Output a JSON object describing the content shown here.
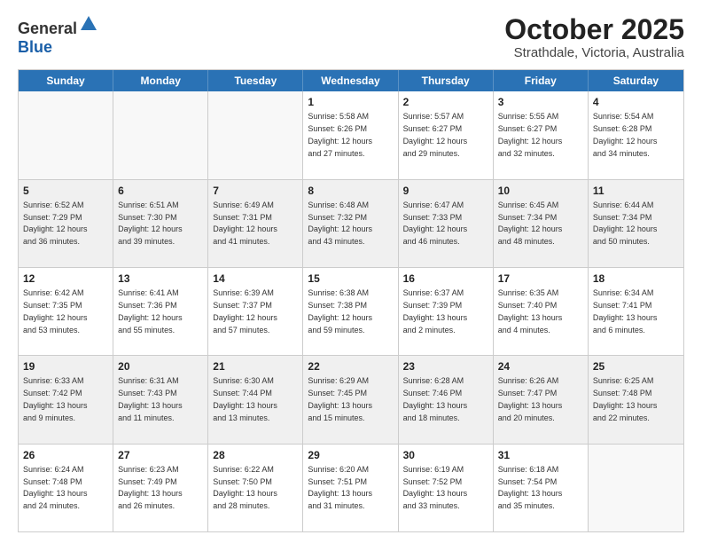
{
  "header": {
    "logo": {
      "general": "General",
      "blue": "Blue"
    },
    "title": "October 2025",
    "location": "Strathdale, Victoria, Australia"
  },
  "days_of_week": [
    "Sunday",
    "Monday",
    "Tuesday",
    "Wednesday",
    "Thursday",
    "Friday",
    "Saturday"
  ],
  "weeks": [
    [
      {
        "day": "",
        "info": ""
      },
      {
        "day": "",
        "info": ""
      },
      {
        "day": "",
        "info": ""
      },
      {
        "day": "1",
        "info": "Sunrise: 5:58 AM\nSunset: 6:26 PM\nDaylight: 12 hours\nand 27 minutes."
      },
      {
        "day": "2",
        "info": "Sunrise: 5:57 AM\nSunset: 6:27 PM\nDaylight: 12 hours\nand 29 minutes."
      },
      {
        "day": "3",
        "info": "Sunrise: 5:55 AM\nSunset: 6:27 PM\nDaylight: 12 hours\nand 32 minutes."
      },
      {
        "day": "4",
        "info": "Sunrise: 5:54 AM\nSunset: 6:28 PM\nDaylight: 12 hours\nand 34 minutes."
      }
    ],
    [
      {
        "day": "5",
        "info": "Sunrise: 6:52 AM\nSunset: 7:29 PM\nDaylight: 12 hours\nand 36 minutes."
      },
      {
        "day": "6",
        "info": "Sunrise: 6:51 AM\nSunset: 7:30 PM\nDaylight: 12 hours\nand 39 minutes."
      },
      {
        "day": "7",
        "info": "Sunrise: 6:49 AM\nSunset: 7:31 PM\nDaylight: 12 hours\nand 41 minutes."
      },
      {
        "day": "8",
        "info": "Sunrise: 6:48 AM\nSunset: 7:32 PM\nDaylight: 12 hours\nand 43 minutes."
      },
      {
        "day": "9",
        "info": "Sunrise: 6:47 AM\nSunset: 7:33 PM\nDaylight: 12 hours\nand 46 minutes."
      },
      {
        "day": "10",
        "info": "Sunrise: 6:45 AM\nSunset: 7:34 PM\nDaylight: 12 hours\nand 48 minutes."
      },
      {
        "day": "11",
        "info": "Sunrise: 6:44 AM\nSunset: 7:34 PM\nDaylight: 12 hours\nand 50 minutes."
      }
    ],
    [
      {
        "day": "12",
        "info": "Sunrise: 6:42 AM\nSunset: 7:35 PM\nDaylight: 12 hours\nand 53 minutes."
      },
      {
        "day": "13",
        "info": "Sunrise: 6:41 AM\nSunset: 7:36 PM\nDaylight: 12 hours\nand 55 minutes."
      },
      {
        "day": "14",
        "info": "Sunrise: 6:39 AM\nSunset: 7:37 PM\nDaylight: 12 hours\nand 57 minutes."
      },
      {
        "day": "15",
        "info": "Sunrise: 6:38 AM\nSunset: 7:38 PM\nDaylight: 12 hours\nand 59 minutes."
      },
      {
        "day": "16",
        "info": "Sunrise: 6:37 AM\nSunset: 7:39 PM\nDaylight: 13 hours\nand 2 minutes."
      },
      {
        "day": "17",
        "info": "Sunrise: 6:35 AM\nSunset: 7:40 PM\nDaylight: 13 hours\nand 4 minutes."
      },
      {
        "day": "18",
        "info": "Sunrise: 6:34 AM\nSunset: 7:41 PM\nDaylight: 13 hours\nand 6 minutes."
      }
    ],
    [
      {
        "day": "19",
        "info": "Sunrise: 6:33 AM\nSunset: 7:42 PM\nDaylight: 13 hours\nand 9 minutes."
      },
      {
        "day": "20",
        "info": "Sunrise: 6:31 AM\nSunset: 7:43 PM\nDaylight: 13 hours\nand 11 minutes."
      },
      {
        "day": "21",
        "info": "Sunrise: 6:30 AM\nSunset: 7:44 PM\nDaylight: 13 hours\nand 13 minutes."
      },
      {
        "day": "22",
        "info": "Sunrise: 6:29 AM\nSunset: 7:45 PM\nDaylight: 13 hours\nand 15 minutes."
      },
      {
        "day": "23",
        "info": "Sunrise: 6:28 AM\nSunset: 7:46 PM\nDaylight: 13 hours\nand 18 minutes."
      },
      {
        "day": "24",
        "info": "Sunrise: 6:26 AM\nSunset: 7:47 PM\nDaylight: 13 hours\nand 20 minutes."
      },
      {
        "day": "25",
        "info": "Sunrise: 6:25 AM\nSunset: 7:48 PM\nDaylight: 13 hours\nand 22 minutes."
      }
    ],
    [
      {
        "day": "26",
        "info": "Sunrise: 6:24 AM\nSunset: 7:48 PM\nDaylight: 13 hours\nand 24 minutes."
      },
      {
        "day": "27",
        "info": "Sunrise: 6:23 AM\nSunset: 7:49 PM\nDaylight: 13 hours\nand 26 minutes."
      },
      {
        "day": "28",
        "info": "Sunrise: 6:22 AM\nSunset: 7:50 PM\nDaylight: 13 hours\nand 28 minutes."
      },
      {
        "day": "29",
        "info": "Sunrise: 6:20 AM\nSunset: 7:51 PM\nDaylight: 13 hours\nand 31 minutes."
      },
      {
        "day": "30",
        "info": "Sunrise: 6:19 AM\nSunset: 7:52 PM\nDaylight: 13 hours\nand 33 minutes."
      },
      {
        "day": "31",
        "info": "Sunrise: 6:18 AM\nSunset: 7:54 PM\nDaylight: 13 hours\nand 35 minutes."
      },
      {
        "day": "",
        "info": ""
      }
    ]
  ]
}
